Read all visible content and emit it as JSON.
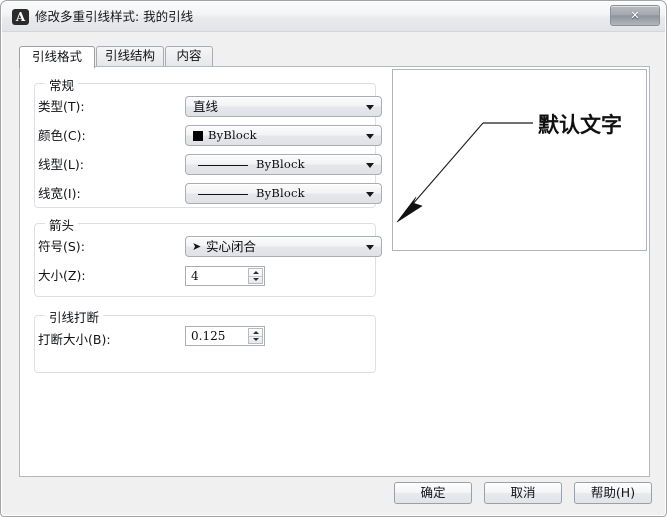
{
  "window": {
    "title": "修改多重引线样式: 我的引线",
    "logo_letter": "A",
    "close_label": "✕"
  },
  "tabs": [
    {
      "label": "引线格式",
      "active": true
    },
    {
      "label": "引线结构",
      "active": false
    },
    {
      "label": "内容",
      "active": false
    }
  ],
  "groups": {
    "general": {
      "title": "常规",
      "fields": {
        "type": {
          "label": "类型(T):",
          "value": "直线"
        },
        "color": {
          "label": "颜色(C):",
          "value": "ByBlock",
          "swatch": "#000000"
        },
        "linetype": {
          "label": "线型(L):",
          "value": "ByBlock"
        },
        "lineweight": {
          "label": "线宽(I):",
          "value": "ByBlock"
        }
      }
    },
    "arrowhead": {
      "title": "箭头",
      "fields": {
        "symbol": {
          "label": "符号(S):",
          "value": "实心闭合",
          "glyph": "➤"
        },
        "size": {
          "label": "大小(Z):",
          "value": "4"
        }
      }
    },
    "leader_break": {
      "title": "引线打断",
      "fields": {
        "break_size": {
          "label": "打断大小(B):",
          "value": "0.125"
        }
      }
    }
  },
  "preview": {
    "text": "默认文字",
    "line_color": "#1a1a1a",
    "background": "#ffffff"
  },
  "buttons": {
    "ok": "确定",
    "cancel": "取消",
    "help": "帮助(H)"
  }
}
